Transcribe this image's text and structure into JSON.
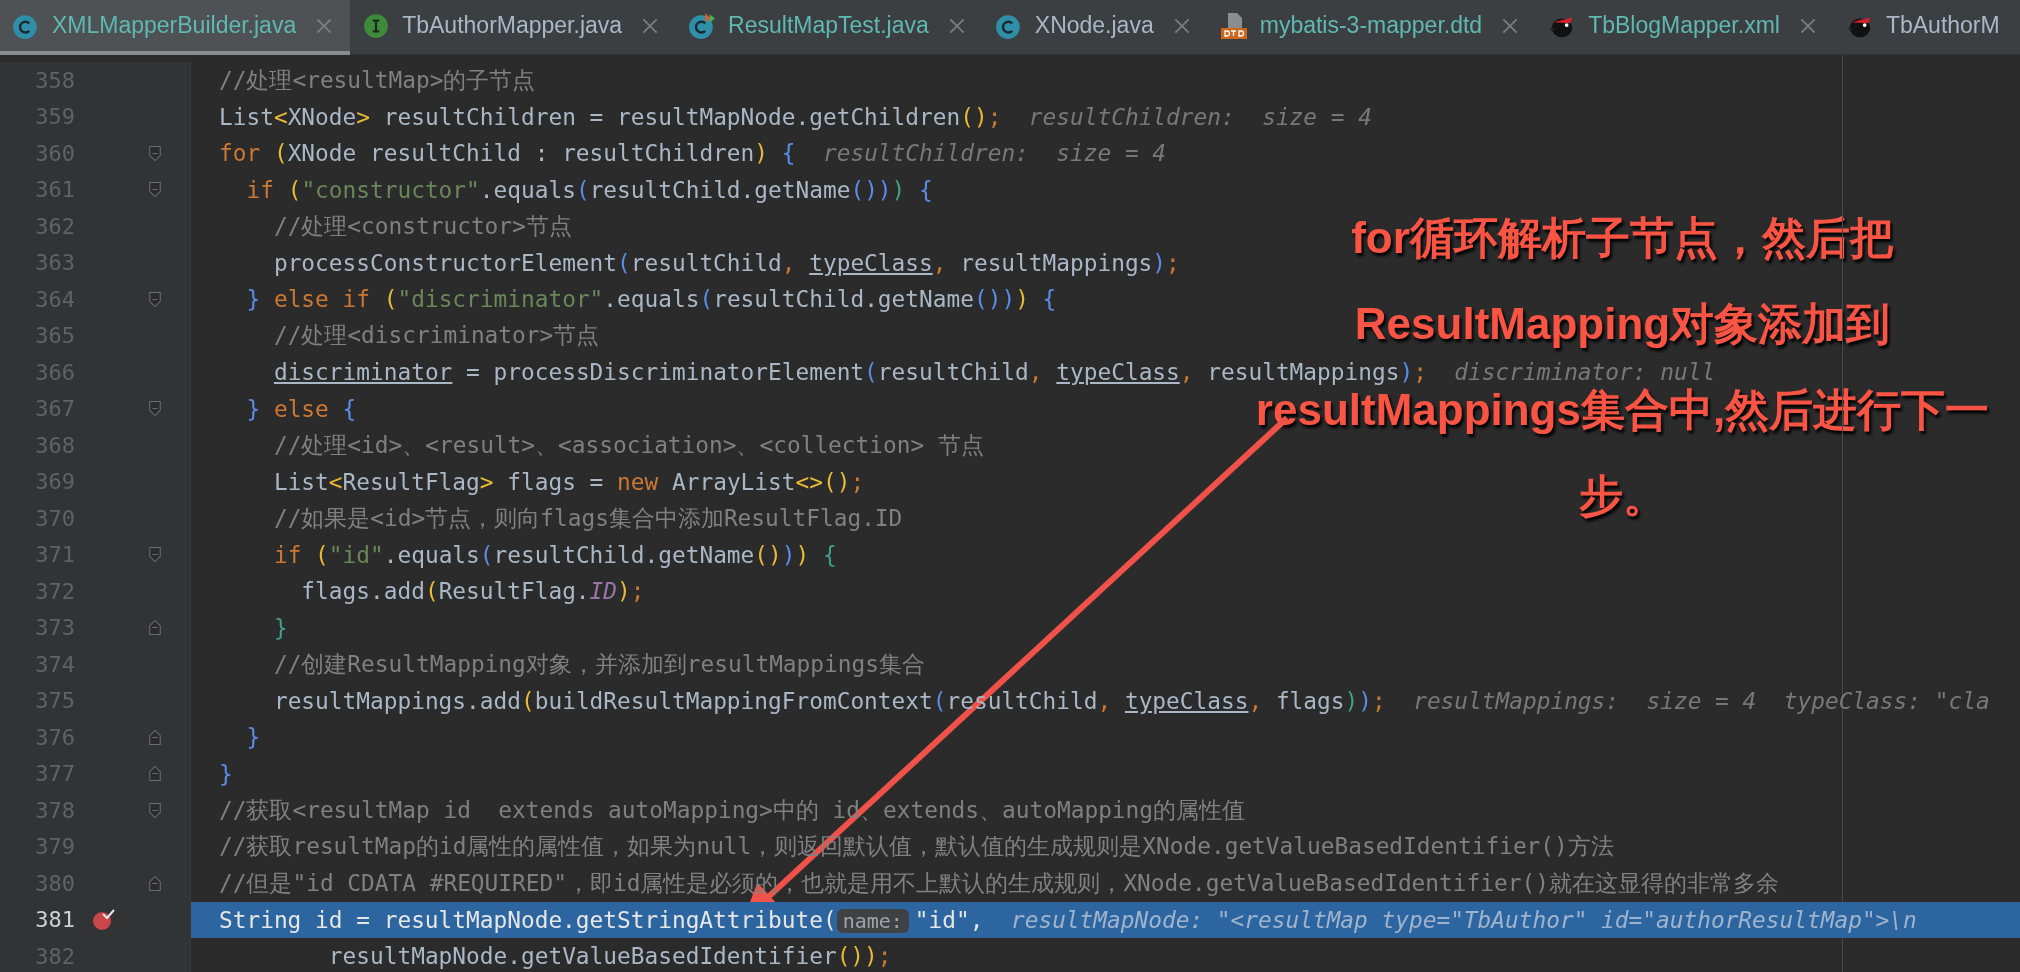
{
  "tabs": [
    {
      "label": "XMLMapperBuilder.java",
      "kind": "class",
      "selected": true,
      "color": "#5fb8b2",
      "closable": true
    },
    {
      "label": "TbAuthorMapper.java",
      "kind": "interface",
      "selected": false,
      "color": "#a9b7c6",
      "closable": true
    },
    {
      "label": "ResultMapTest.java",
      "kind": "test",
      "selected": false,
      "color": "#5fb8b2",
      "closable": true
    },
    {
      "label": "XNode.java",
      "kind": "class",
      "selected": false,
      "color": "#a9b7c6",
      "closable": true
    },
    {
      "label": "mybatis-3-mapper.dtd",
      "kind": "dtd",
      "selected": false,
      "color": "#5fb8b2",
      "closable": true
    },
    {
      "label": "TbBlogMapper.xml",
      "kind": "xml",
      "selected": false,
      "color": "#5fb8b2",
      "closable": true
    },
    {
      "label": "TbAuthorM",
      "kind": "xml",
      "selected": false,
      "color": "#a9b7c6",
      "closable": false
    }
  ],
  "lines": [
    {
      "number": "358",
      "tokens": [
        {
          "t": "//处理<resultMap>的子节点",
          "kind": "comment"
        }
      ]
    },
    {
      "number": "359",
      "tokens": [
        {
          "t": "List",
          "kind": "plain"
        },
        {
          "t": "<",
          "kind": "bracket"
        },
        {
          "t": "XNode",
          "kind": "plain"
        },
        {
          "t": ">",
          "kind": "bracket"
        },
        {
          "t": " resultChildren = resultMapNode.getChildren",
          "kind": "plain"
        },
        {
          "t": "()",
          "kind": "bracket"
        },
        {
          "t": ";",
          "kind": "keyword"
        },
        {
          "t": "  resultChildren:  size = 4",
          "kind": "hint"
        }
      ]
    },
    {
      "number": "360",
      "fold_open": true,
      "tokens": [
        {
          "t": "for ",
          "kind": "keyword"
        },
        {
          "t": "(",
          "kind": "bracket"
        },
        {
          "t": "XNode resultChild : resultChildren",
          "kind": "plain"
        },
        {
          "t": ")",
          "kind": "bracket"
        },
        {
          "t": " {",
          "kind": "brace"
        },
        {
          "t": "  resultChildren:  size = 4",
          "kind": "hint"
        }
      ]
    },
    {
      "number": "361",
      "fold_open": true,
      "tokens": [
        {
          "t": "  if ",
          "kind": "keyword"
        },
        {
          "t": "(",
          "kind": "bracket"
        },
        {
          "t": "\"constructor\"",
          "kind": "string"
        },
        {
          "t": ".equals",
          "kind": "plain"
        },
        {
          "t": "(",
          "kind": "brace"
        },
        {
          "t": "resultChild.getName",
          "kind": "plain"
        },
        {
          "t": "()",
          "kind": "brace"
        },
        {
          "t": ")",
          "kind": "brace"
        },
        {
          "t": ")",
          "kind": "block"
        },
        {
          "t": " {",
          "kind": "brace"
        }
      ]
    },
    {
      "number": "362",
      "tokens": [
        {
          "t": "    //处理<constructor>节点",
          "kind": "comment"
        }
      ]
    },
    {
      "number": "363",
      "tokens": [
        {
          "t": "    processConstructorElement",
          "kind": "plain"
        },
        {
          "t": "(",
          "kind": "brace"
        },
        {
          "t": "resultChild",
          "kind": "plain"
        },
        {
          "t": ", ",
          "kind": "keyword"
        },
        {
          "t": "typeClass",
          "kind": "field"
        },
        {
          "t": ", ",
          "kind": "keyword"
        },
        {
          "t": "resultMappings",
          "kind": "plain"
        },
        {
          "t": ")",
          "kind": "brace"
        },
        {
          "t": ";",
          "kind": "keyword"
        }
      ]
    },
    {
      "number": "364",
      "fold_open": true,
      "tokens": [
        {
          "t": "  }",
          "kind": "brace"
        },
        {
          "t": " else if ",
          "kind": "keyword"
        },
        {
          "t": "(",
          "kind": "bracket"
        },
        {
          "t": "\"discriminator\"",
          "kind": "string"
        },
        {
          "t": ".equals",
          "kind": "plain"
        },
        {
          "t": "(",
          "kind": "brace"
        },
        {
          "t": "resultChild.getName",
          "kind": "plain"
        },
        {
          "t": "()",
          "kind": "brace"
        },
        {
          "t": ")",
          "kind": "brace"
        },
        {
          "t": ")",
          "kind": "bracket"
        },
        {
          "t": " {",
          "kind": "brace"
        }
      ]
    },
    {
      "number": "365",
      "tokens": [
        {
          "t": "    //处理<discriminator>节点",
          "kind": "comment"
        }
      ]
    },
    {
      "number": "366",
      "tokens": [
        {
          "t": "    discriminator",
          "kind": "field"
        },
        {
          "t": " = processDiscriminatorElement",
          "kind": "plain"
        },
        {
          "t": "(",
          "kind": "brace"
        },
        {
          "t": "resultChild",
          "kind": "plain"
        },
        {
          "t": ", ",
          "kind": "keyword"
        },
        {
          "t": "typeClass",
          "kind": "field"
        },
        {
          "t": ", ",
          "kind": "keyword"
        },
        {
          "t": "resultMappings",
          "kind": "plain"
        },
        {
          "t": ")",
          "kind": "brace"
        },
        {
          "t": ";",
          "kind": "keyword"
        },
        {
          "t": "  discriminator: null",
          "kind": "hint"
        }
      ]
    },
    {
      "number": "367",
      "fold_open": true,
      "tokens": [
        {
          "t": "  }",
          "kind": "brace"
        },
        {
          "t": " else ",
          "kind": "keyword"
        },
        {
          "t": "{",
          "kind": "brace"
        }
      ]
    },
    {
      "number": "368",
      "tokens": [
        {
          "t": "    //处理<id>、<result>、<association>、<collection> 节点",
          "kind": "comment"
        }
      ]
    },
    {
      "number": "369",
      "tokens": [
        {
          "t": "    List",
          "kind": "plain"
        },
        {
          "t": "<",
          "kind": "bracket"
        },
        {
          "t": "ResultFlag",
          "kind": "plain"
        },
        {
          "t": ">",
          "kind": "bracket"
        },
        {
          "t": " flags = ",
          "kind": "plain"
        },
        {
          "t": "new ",
          "kind": "keyword"
        },
        {
          "t": "ArrayList",
          "kind": "plain"
        },
        {
          "t": "<>",
          "kind": "bracket"
        },
        {
          "t": "()",
          "kind": "bracket"
        },
        {
          "t": ";",
          "kind": "keyword"
        }
      ]
    },
    {
      "number": "370",
      "tokens": [
        {
          "t": "    //如果是<id>节点，则向flags集合中添加ResultFlag.ID",
          "kind": "comment"
        }
      ]
    },
    {
      "number": "371",
      "fold_open": true,
      "tokens": [
        {
          "t": "    if ",
          "kind": "keyword"
        },
        {
          "t": "(",
          "kind": "bracket"
        },
        {
          "t": "\"id\"",
          "kind": "string"
        },
        {
          "t": ".equals",
          "kind": "plain"
        },
        {
          "t": "(",
          "kind": "brace"
        },
        {
          "t": "resultChild.getName",
          "kind": "plain"
        },
        {
          "t": "()",
          "kind": "bracket"
        },
        {
          "t": ")",
          "kind": "brace"
        },
        {
          "t": ")",
          "kind": "bracket"
        },
        {
          "t": " {",
          "kind": "block"
        }
      ]
    },
    {
      "number": "372",
      "tokens": [
        {
          "t": "      flags.add",
          "kind": "plain"
        },
        {
          "t": "(",
          "kind": "bracket"
        },
        {
          "t": "ResultFlag.",
          "kind": "plain"
        },
        {
          "t": "ID",
          "kind": "constant"
        },
        {
          "t": ")",
          "kind": "bracket"
        },
        {
          "t": ";",
          "kind": "keyword"
        }
      ]
    },
    {
      "number": "373",
      "fold_close": true,
      "tokens": [
        {
          "t": "    }",
          "kind": "block"
        }
      ]
    },
    {
      "number": "374",
      "tokens": [
        {
          "t": "    //创建ResultMapping对象，并添加到resultMappings集合",
          "kind": "comment"
        }
      ]
    },
    {
      "number": "375",
      "tokens": [
        {
          "t": "    resultMappings.add",
          "kind": "plain"
        },
        {
          "t": "(",
          "kind": "bracket"
        },
        {
          "t": "buildResultMappingFromContext",
          "kind": "plain"
        },
        {
          "t": "(",
          "kind": "brace"
        },
        {
          "t": "resultChild",
          "kind": "plain"
        },
        {
          "t": ", ",
          "kind": "keyword"
        },
        {
          "t": "typeClass",
          "kind": "field"
        },
        {
          "t": ", ",
          "kind": "keyword"
        },
        {
          "t": "flags",
          "kind": "plain"
        },
        {
          "t": ")",
          "kind": "block"
        },
        {
          "t": ")",
          "kind": "brace"
        },
        {
          "t": ";",
          "kind": "keyword"
        },
        {
          "t": "  resultMappings:  size = 4  typeClass: \"cla",
          "kind": "hint"
        }
      ]
    },
    {
      "number": "376",
      "fold_close": true,
      "tokens": [
        {
          "t": "  }",
          "kind": "brace"
        }
      ]
    },
    {
      "number": "377",
      "fold_close": true,
      "tokens": [
        {
          "t": "}",
          "kind": "brace"
        }
      ]
    },
    {
      "number": "378",
      "fold_open": true,
      "tokens": [
        {
          "t": "//获取<resultMap id  extends autoMapping>中的 id、extends、autoMapping的属性值",
          "kind": "comment"
        }
      ]
    },
    {
      "number": "379",
      "tokens": [
        {
          "t": "//获取resultMap的id属性的属性值，如果为null，则返回默认值，默认值的生成规则是XNode.getValueBasedIdentifier()方法",
          "kind": "comment"
        }
      ]
    },
    {
      "number": "380",
      "fold_close": true,
      "tokens": [
        {
          "t": "//但是\"id CDATA #REQUIRED\"，即id属性是必须的，也就是用不上默认的生成规则，XNode.getValueBasedIdentifier()就在这显得的非常多余",
          "kind": "comment"
        }
      ]
    },
    {
      "number": "381",
      "current": true,
      "breakpoint": true,
      "tokens": [
        {
          "t": "String id = resultMapNode.getStringAttribute",
          "kind": "plain"
        },
        {
          "t": "(",
          "kind": "bracket"
        },
        {
          "t": "name:",
          "kind": "param"
        },
        {
          "t": "\"id\"",
          "kind": "string"
        },
        {
          "t": ",",
          "kind": "keyword"
        },
        {
          "t": "  resultMapNode: \"<resultMap type=\"TbAuthor\" id=\"authorResultMap\">\\n",
          "kind": "hint"
        }
      ]
    },
    {
      "number": "382",
      "tokens": [
        {
          "t": "        resultMapNode.getValueBasedIdentifier",
          "kind": "plain"
        },
        {
          "t": "()",
          "kind": "bracket"
        },
        {
          "t": ")",
          "kind": "bracket"
        },
        {
          "t": ";",
          "kind": "keyword"
        }
      ]
    }
  ],
  "annotation": {
    "lines": [
      "for循环解析子节点，然后把",
      "ResultMapping对象添加到",
      "resultMappings集合中,然后进行下一",
      "步。"
    ]
  }
}
